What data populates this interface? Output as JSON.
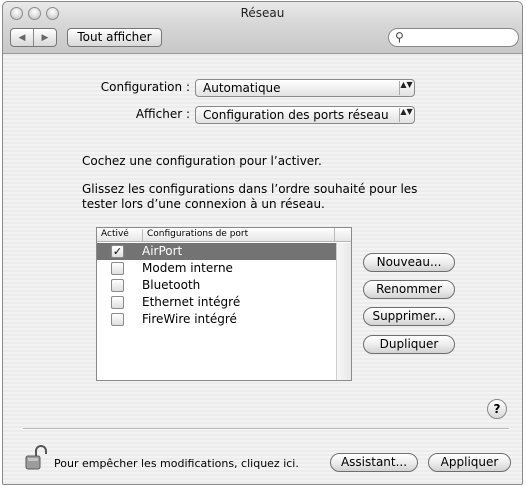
{
  "window": {
    "title": "Réseau"
  },
  "toolbar": {
    "back_icon": "back-arrow-icon",
    "forward_icon": "forward-arrow-icon",
    "back_glyph": "◀",
    "forward_glyph": "▶",
    "show_all_label": "Tout afficher",
    "search_icon": "magnifier-icon",
    "search_glyph": "⚲",
    "search_value": ""
  },
  "form": {
    "configuration_label": "Configuration :",
    "configuration_value": "Automatique",
    "show_label": "Afficher :",
    "show_value": "Configuration des ports réseau",
    "popup_arrows": "▲▼"
  },
  "instructions": {
    "line1": "Cochez une configuration pour l’activer.",
    "line2": "Glissez les configurations dans l’ordre souhaité pour les tester lors d’une connexion à un réseau."
  },
  "port_list": {
    "columns": [
      "Activé",
      "Configurations de port"
    ],
    "rows": [
      {
        "active": true,
        "name": "AirPort",
        "selected": true
      },
      {
        "active": false,
        "name": "Modem interne",
        "selected": false
      },
      {
        "active": false,
        "name": "Bluetooth",
        "selected": false
      },
      {
        "active": false,
        "name": "Ethernet intégré",
        "selected": false
      },
      {
        "active": false,
        "name": "FireWire intégré",
        "selected": false
      }
    ],
    "check_glyph": "✓"
  },
  "actions": {
    "new_label": "Nouveau...",
    "rename_label": "Renommer",
    "delete_label": "Supprimer...",
    "duplicate_label": "Dupliquer"
  },
  "help": {
    "glyph": "?"
  },
  "footer": {
    "lock_icon": "unlocked-padlock-icon",
    "lock_text": "Pour empêcher les modifications, cliquez ici.",
    "assistant_label": "Assistant...",
    "apply_label": "Appliquer"
  },
  "colors": {
    "selection": "#737373",
    "window_background": "#ececec"
  }
}
